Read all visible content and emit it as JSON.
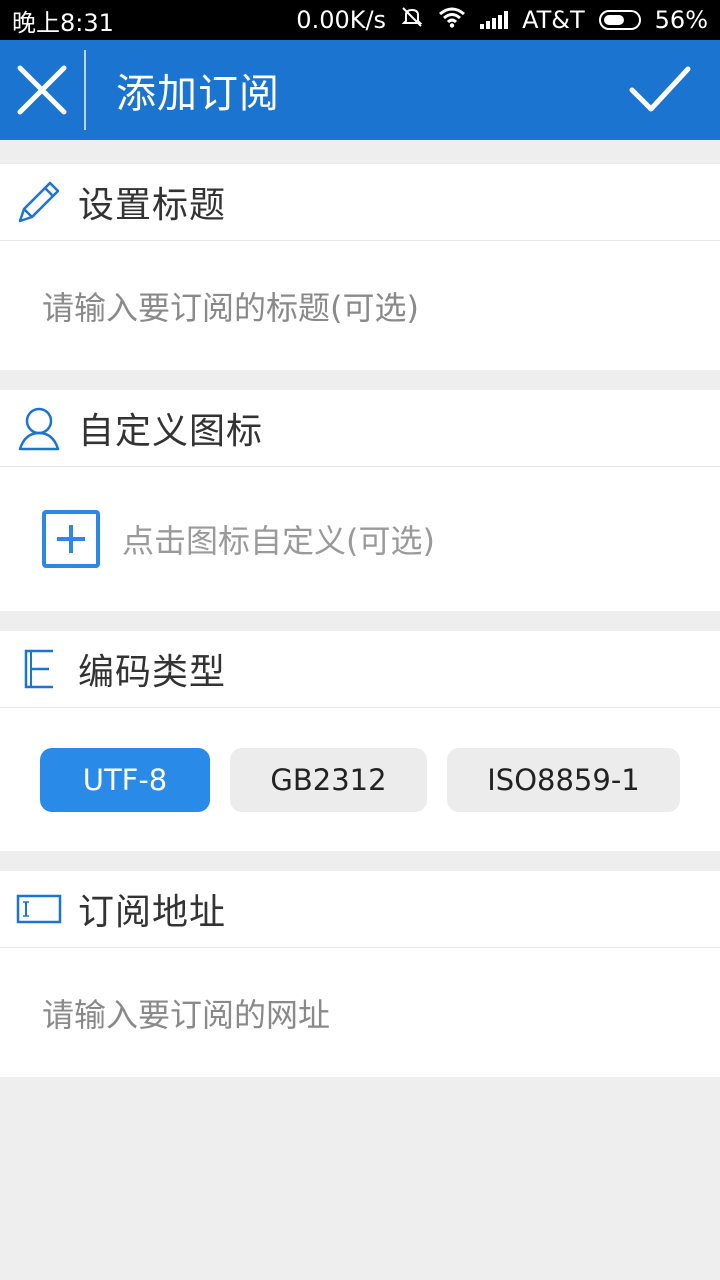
{
  "status": {
    "time": "晚上8:31",
    "speed": "0.00K/s",
    "carrier": "AT&T",
    "battery": "56%"
  },
  "appbar": {
    "title": "添加订阅",
    "close_icon": "close-icon",
    "confirm_icon": "check-icon"
  },
  "sections": {
    "title": {
      "label": "设置标题",
      "icon": "pencil-icon",
      "placeholder": "请输入要订阅的标题(可选)"
    },
    "icon": {
      "label": "自定义图标",
      "icon": "user-icon",
      "hint": "点击图标自定义(可选)"
    },
    "encoding": {
      "label": "编码类型",
      "icon": "encoding-icon",
      "options": [
        "UTF-8",
        "GB2312",
        "ISO8859-1"
      ],
      "selected": "UTF-8"
    },
    "url": {
      "label": "订阅地址",
      "icon": "text-field-icon",
      "placeholder": "请输入要订阅的网址"
    }
  },
  "colors": {
    "primary": "#1b74d0",
    "accent": "#2a8ae8",
    "background": "#eeeeee"
  }
}
